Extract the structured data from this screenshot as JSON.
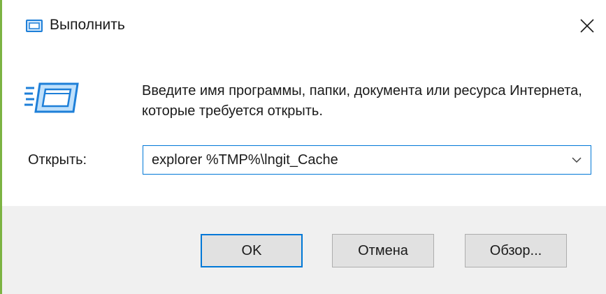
{
  "window": {
    "title": "Выполнить"
  },
  "prompt": {
    "description": "Введите имя программы, папки, документа или ресурса Интернета, которые требуется открыть."
  },
  "open_field": {
    "label": "Открыть:",
    "value": "explorer %TMP%\\lngit_Cache"
  },
  "buttons": {
    "ok": "OK",
    "cancel": "Отмена",
    "browse": "Обзор..."
  },
  "icons": {
    "title": "run-icon",
    "large": "run-icon",
    "close": "close-icon",
    "dropdown": "chevron-down-icon"
  },
  "colors": {
    "accent": "#0078d7",
    "window_border": "#7cb342",
    "icon_blue": "#1e7fd8",
    "footer_bg": "#f0f0f0"
  }
}
